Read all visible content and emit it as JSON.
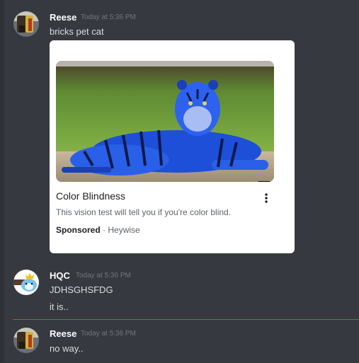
{
  "messages": [
    {
      "author": "Reese",
      "timestamp": "Today at 5:36 PM",
      "lines": [
        "bricks pet cat"
      ],
      "embed": {
        "title": "Color Blindness",
        "description": "This vision test will tell you if you're color blind.",
        "sponsored_label": "Sponsored",
        "separator": "·",
        "source": "Heywise"
      }
    },
    {
      "author": "HQC",
      "timestamp": "Today at 5:36 PM",
      "lines": [
        "JDHSGHSFDG",
        "it is.."
      ]
    },
    {
      "author": "Reese",
      "timestamp": "Today at 5:36 PM",
      "lines": [
        "no way.."
      ]
    }
  ],
  "colors": {
    "background": "#36393f",
    "username": "#ffffff",
    "timestamp": "#72767d",
    "message_text": "#dcddde",
    "new_messages_divider": "#c94144",
    "embed_background": "#ffffff"
  },
  "icons": {
    "external_link": "external-link-icon",
    "more": "more-vertical-icon"
  }
}
